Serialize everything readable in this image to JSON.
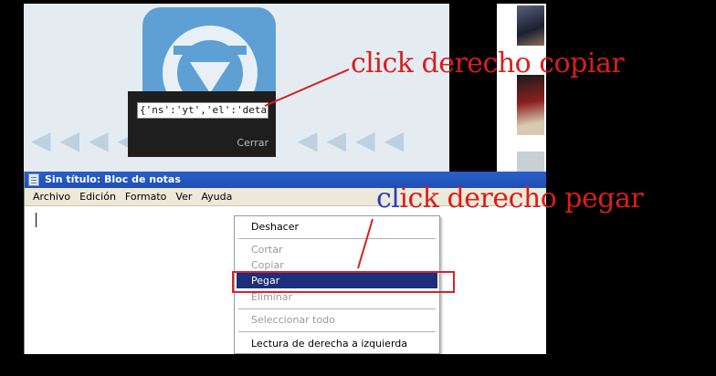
{
  "embed_popup": {
    "embed_code": "{'ns':'yt','el':'detailpage'",
    "close_label": "Cerrar"
  },
  "notepad": {
    "title": "Sin título: Bloc de notas",
    "menus": [
      "Archivo",
      "Edición",
      "Formato",
      "Ver",
      "Ayuda"
    ]
  },
  "context_menu": {
    "items": [
      {
        "label": "Deshacer",
        "enabled": true
      },
      {
        "label": "Cortar",
        "enabled": false
      },
      {
        "label": "Copiar",
        "enabled": false
      },
      {
        "label": "Pegar",
        "enabled": true,
        "selected": true
      },
      {
        "label": "Eliminar",
        "enabled": false
      },
      {
        "label": "Seleccionar todo",
        "enabled": false
      },
      {
        "label": "Lectura de derecha a izquierda",
        "enabled": true
      }
    ]
  },
  "annotations": {
    "copy_note": "click derecho copiar",
    "paste_note_prefix": "cl",
    "paste_note_rest": "ick derecho pegar"
  },
  "colors": {
    "annotation_red": "#d91e1e",
    "annotation_blue": "#2b3fbd",
    "selection_blue": "#1c2f7a",
    "titlebar_blue": "#2a5ec9"
  }
}
